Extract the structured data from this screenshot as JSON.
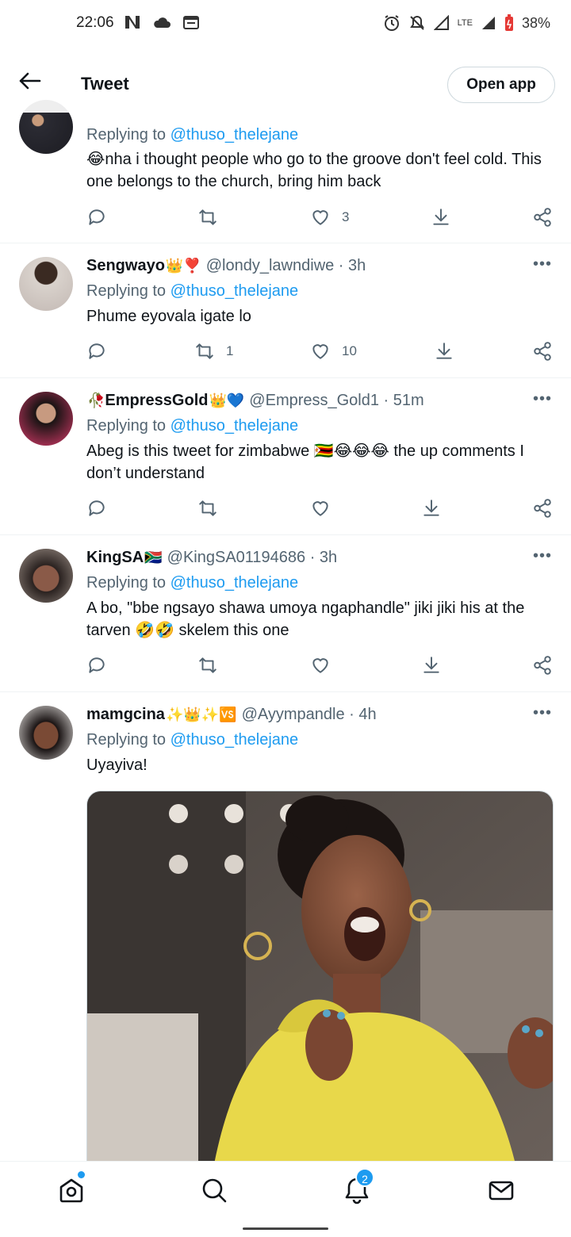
{
  "status_bar": {
    "time": "22:06",
    "left_icons": [
      "netflix-n-icon",
      "cloud-icon",
      "calendar-icon"
    ],
    "right_icons": [
      "alarm-icon",
      "mute-icon",
      "signal-icon",
      "lte-icon",
      "signal-icon",
      "battery-icon"
    ],
    "lte": "LTE",
    "battery": "38%"
  },
  "header": {
    "title": "Tweet",
    "open_app": "Open app"
  },
  "tweets": [
    {
      "name": "",
      "handle": "",
      "replying_label": "Replying to ",
      "mention": "@thuso_thelejane",
      "text": "😂nha i thought people who go to the groove don't feel cold. This one belongs to the church, bring him back",
      "retweets": "",
      "likes": "3"
    },
    {
      "name": "Sengwayo",
      "name_emojis": "👑❣️",
      "handle": "@londy_lawndiwe · 3h",
      "replying_label": "Replying to ",
      "mention": "@thuso_thelejane",
      "text": "Phume eyovala igate lo",
      "retweets": "1",
      "likes": "10"
    },
    {
      "name": "EmpressGold",
      "name_prefix": "🥀",
      "name_emojis": "👑💙",
      "handle": "@Empress_Gold1 · 51m",
      "replying_label": "Replying to ",
      "mention": "@thuso_thelejane",
      "text": "Abeg is this tweet for zimbabwe 🇿🇼😂😂😂 the up comments I don’t understand",
      "retweets": "",
      "likes": ""
    },
    {
      "name": "KingSA",
      "name_emojis": "🇿🇦",
      "handle": "@KingSA01194686 · 3h",
      "replying_label": "Replying to ",
      "mention": "@thuso_thelejane",
      "text": "A bo, \"bbe ngsayo shawa umoya ngaphandle\" jiki jiki his at the tarven 🤣🤣 skelem this one",
      "retweets": "",
      "likes": ""
    },
    {
      "name": "mamgcina",
      "name_emojis": "✨👑✨🆚",
      "handle": "@Ayympandle · 4h",
      "replying_label": "Replying to ",
      "mention": "@thuso_thelejane",
      "text": "Uyayiva!"
    }
  ],
  "more_label": "•••",
  "bottom_nav": {
    "notifications_badge": "2"
  }
}
